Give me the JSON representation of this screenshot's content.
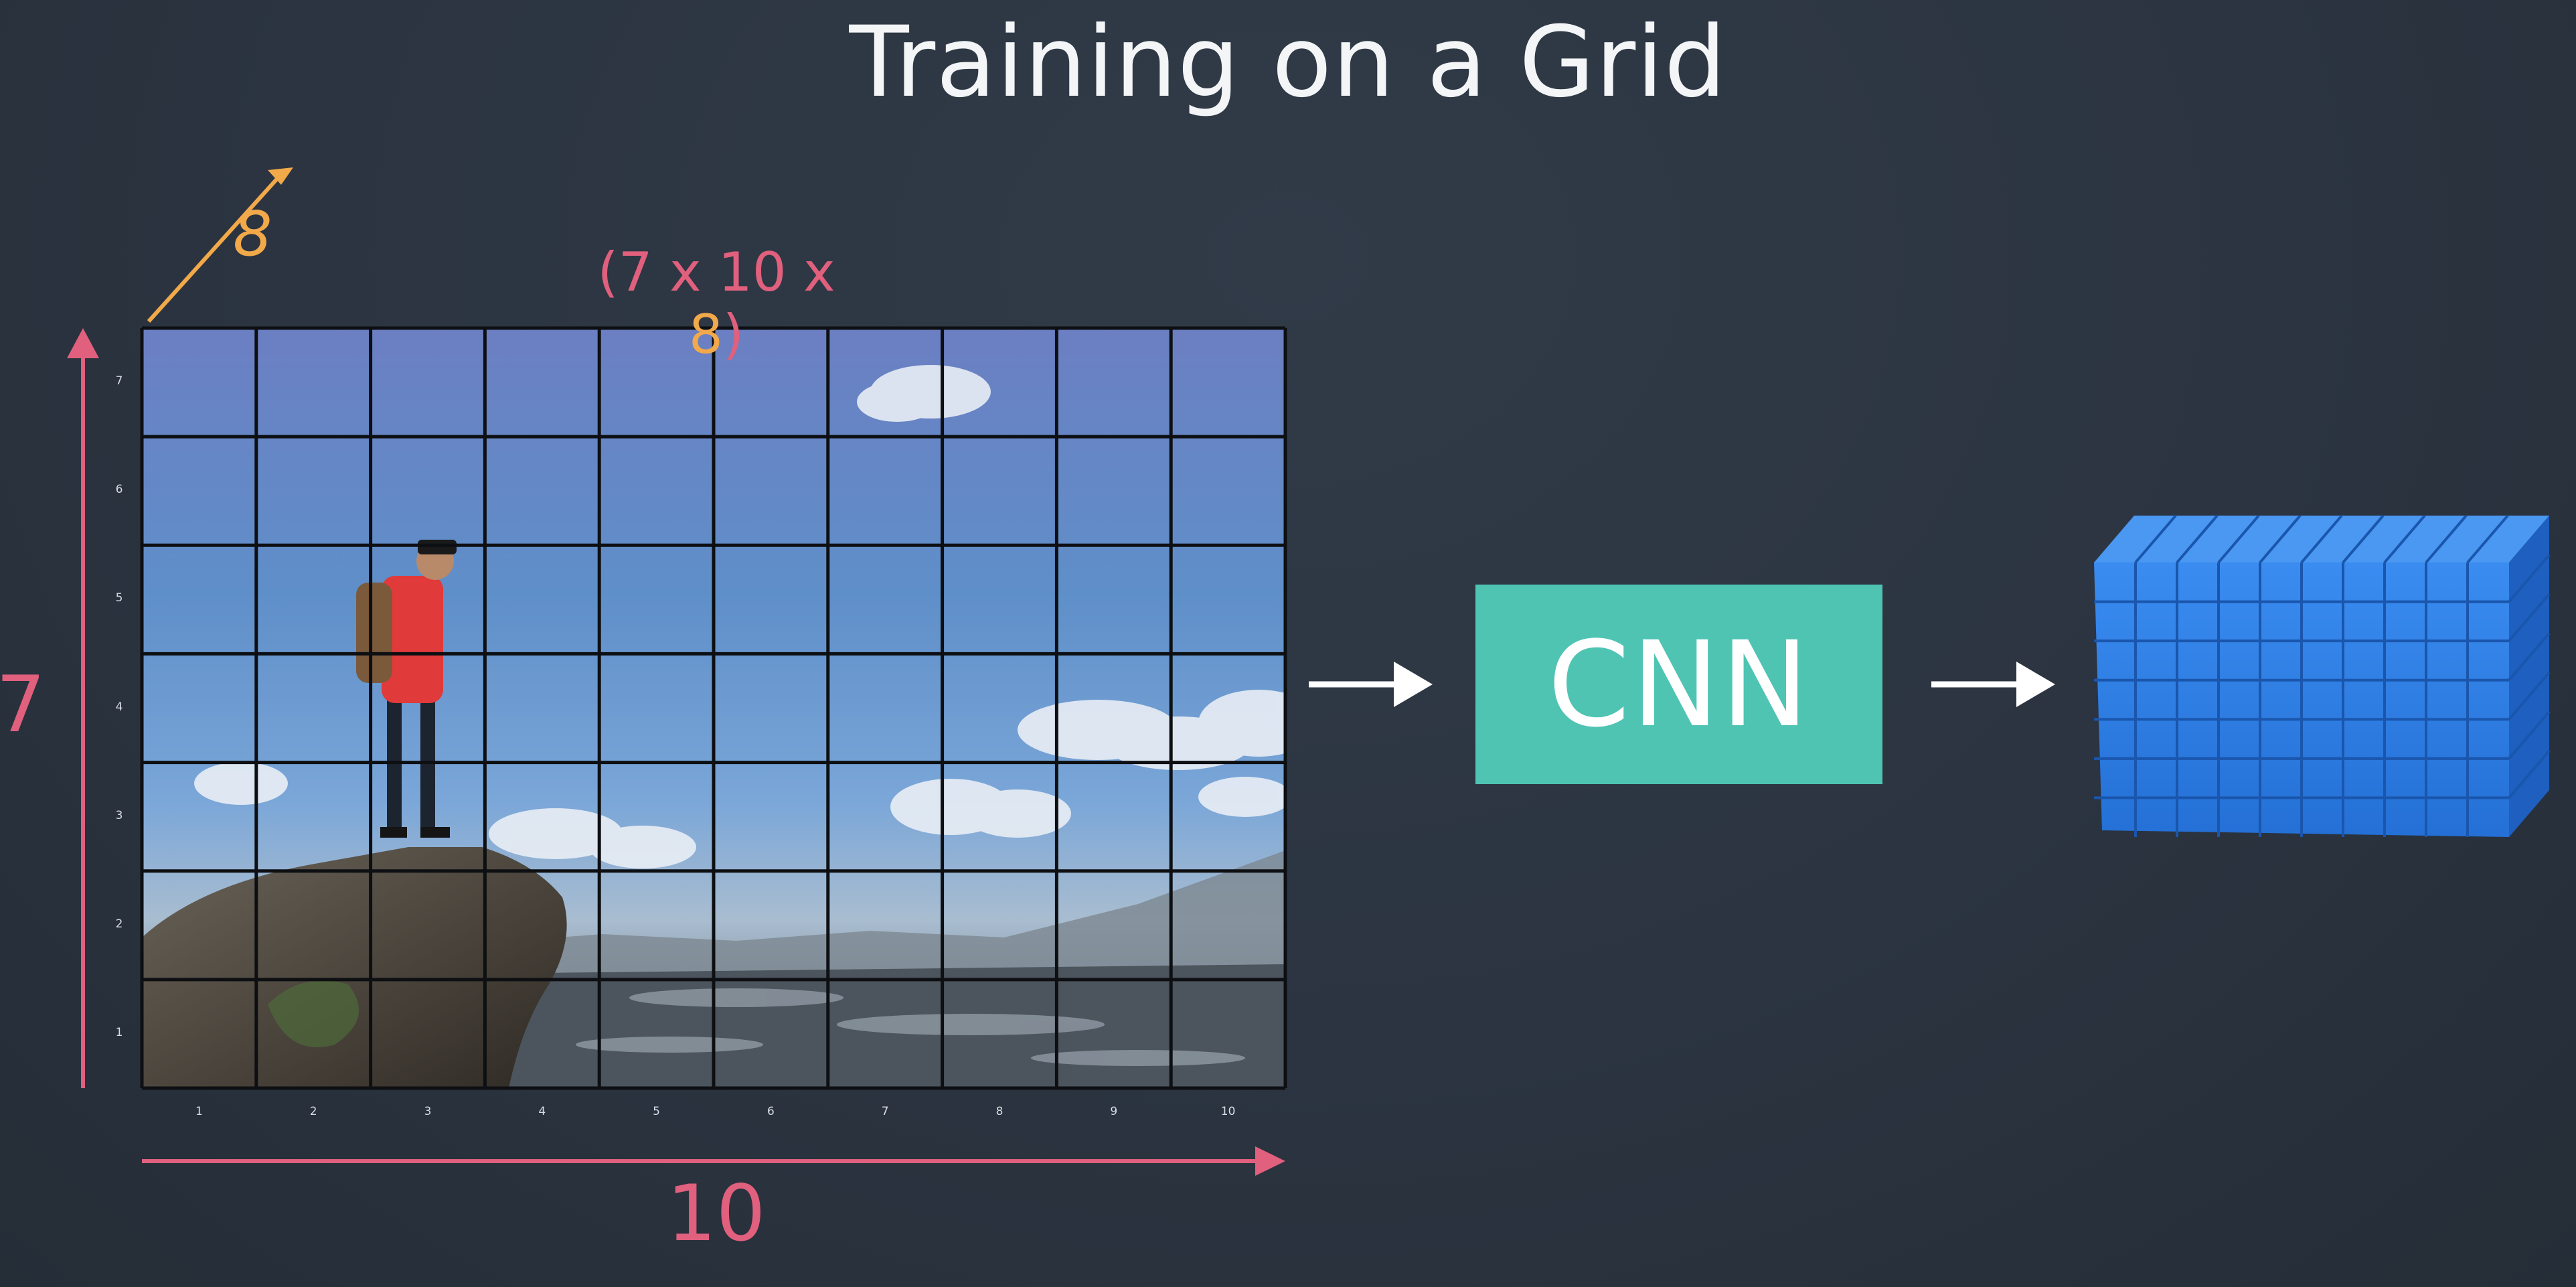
{
  "title": "Training on a Grid",
  "dims": {
    "open": "(",
    "rows": "7",
    "x1": " x ",
    "cols": "10",
    "x2": " x ",
    "depth": "8",
    "close": ")"
  },
  "axes": {
    "height_label": "7",
    "width_label": "10",
    "depth_label": "8"
  },
  "grid": {
    "rows": 7,
    "cols": 10,
    "row_ticks": [
      "7",
      "6",
      "5",
      "4",
      "3",
      "2",
      "1"
    ],
    "col_ticks": [
      "1",
      "2",
      "3",
      "4",
      "5",
      "6",
      "7",
      "8",
      "9",
      "10"
    ]
  },
  "cnn": {
    "label": "CNN"
  },
  "colors": {
    "background": "#2b3440",
    "accent_pink": "#e0607e",
    "accent_orange": "#f2a94a",
    "cnn_box": "#4fc4b3",
    "output_volume": "#2f7fe0"
  },
  "icons": [
    "up-arrow-icon",
    "right-arrow-icon",
    "diagonal-arrow-icon"
  ]
}
